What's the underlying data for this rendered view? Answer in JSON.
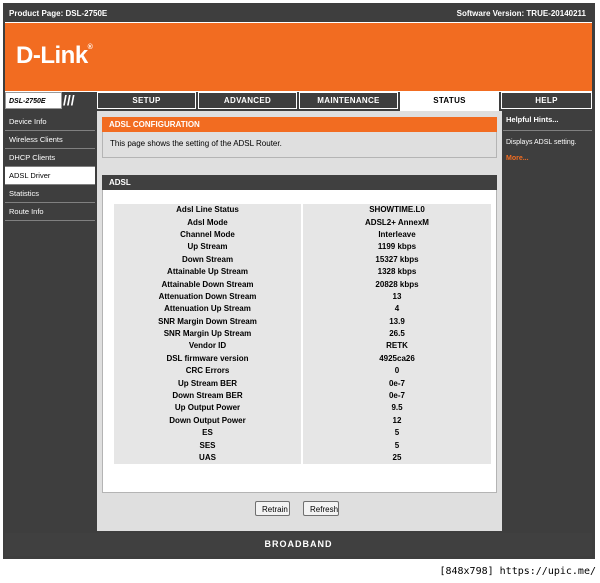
{
  "header": {
    "product_label": "Product Page: DSL-2750E",
    "software_label": "Software Version: TRUE-20140211"
  },
  "brand": {
    "logo_text": "D-Link",
    "logo_mark": "®"
  },
  "model_badge": "DSL-2750E",
  "tabs": [
    {
      "label": "SETUP",
      "active": false
    },
    {
      "label": "ADVANCED",
      "active": false
    },
    {
      "label": "MAINTENANCE",
      "active": false
    },
    {
      "label": "STATUS",
      "active": true
    },
    {
      "label": "HELP",
      "active": false
    }
  ],
  "sidebar": {
    "items": [
      {
        "label": "Device Info",
        "active": false
      },
      {
        "label": "Wireless Clients",
        "active": false
      },
      {
        "label": "DHCP Clients",
        "active": false
      },
      {
        "label": "ADSL Driver",
        "active": true
      },
      {
        "label": "Statistics",
        "active": false
      },
      {
        "label": "Route Info",
        "active": false
      }
    ]
  },
  "main": {
    "section_title": "ADSL CONFIGURATION",
    "description": "This page shows the setting of the ADSL Router.",
    "panel_title": "ADSL",
    "rows": [
      [
        "Adsl Line Status",
        "SHOWTIME.L0"
      ],
      [
        "Adsl Mode",
        "ADSL2+ AnnexM"
      ],
      [
        "Channel Mode",
        "Interleave"
      ],
      [
        "Up Stream",
        "1199 kbps"
      ],
      [
        "Down Stream",
        "15327 kbps"
      ],
      [
        "Attainable Up Stream",
        "1328 kbps"
      ],
      [
        "Attainable Down Stream",
        "20828 kbps"
      ],
      [
        "Attenuation Down Stream",
        "13"
      ],
      [
        "Attenuation Up Stream",
        "4"
      ],
      [
        "SNR Margin Down Stream",
        "13.9"
      ],
      [
        "SNR Margin Up Stream",
        "26.5"
      ],
      [
        "Vendor ID",
        "RETK"
      ],
      [
        "DSL firmware version",
        "4925ca26"
      ],
      [
        "CRC Errors",
        "0"
      ],
      [
        "Up Stream BER",
        "0e-7"
      ],
      [
        "Down Stream BER",
        "0e-7"
      ],
      [
        "Up Output Power",
        "9.5"
      ],
      [
        "Down Output Power",
        "12"
      ],
      [
        "ES",
        "5"
      ],
      [
        "SES",
        "5"
      ],
      [
        "UAS",
        "25"
      ]
    ],
    "buttons": {
      "retrain": "Retrain",
      "refresh": "Refresh"
    }
  },
  "hints": {
    "title": "Helpful Hints...",
    "body": "Displays ADSL setting.",
    "more": "More..."
  },
  "footer": {
    "label": "BROADBAND"
  },
  "watermark": "[848x798] https://upic.me/",
  "colors": {
    "accent": "#f26c21",
    "dark": "#3e3e3e",
    "panel_gray": "#dfdfdf"
  }
}
